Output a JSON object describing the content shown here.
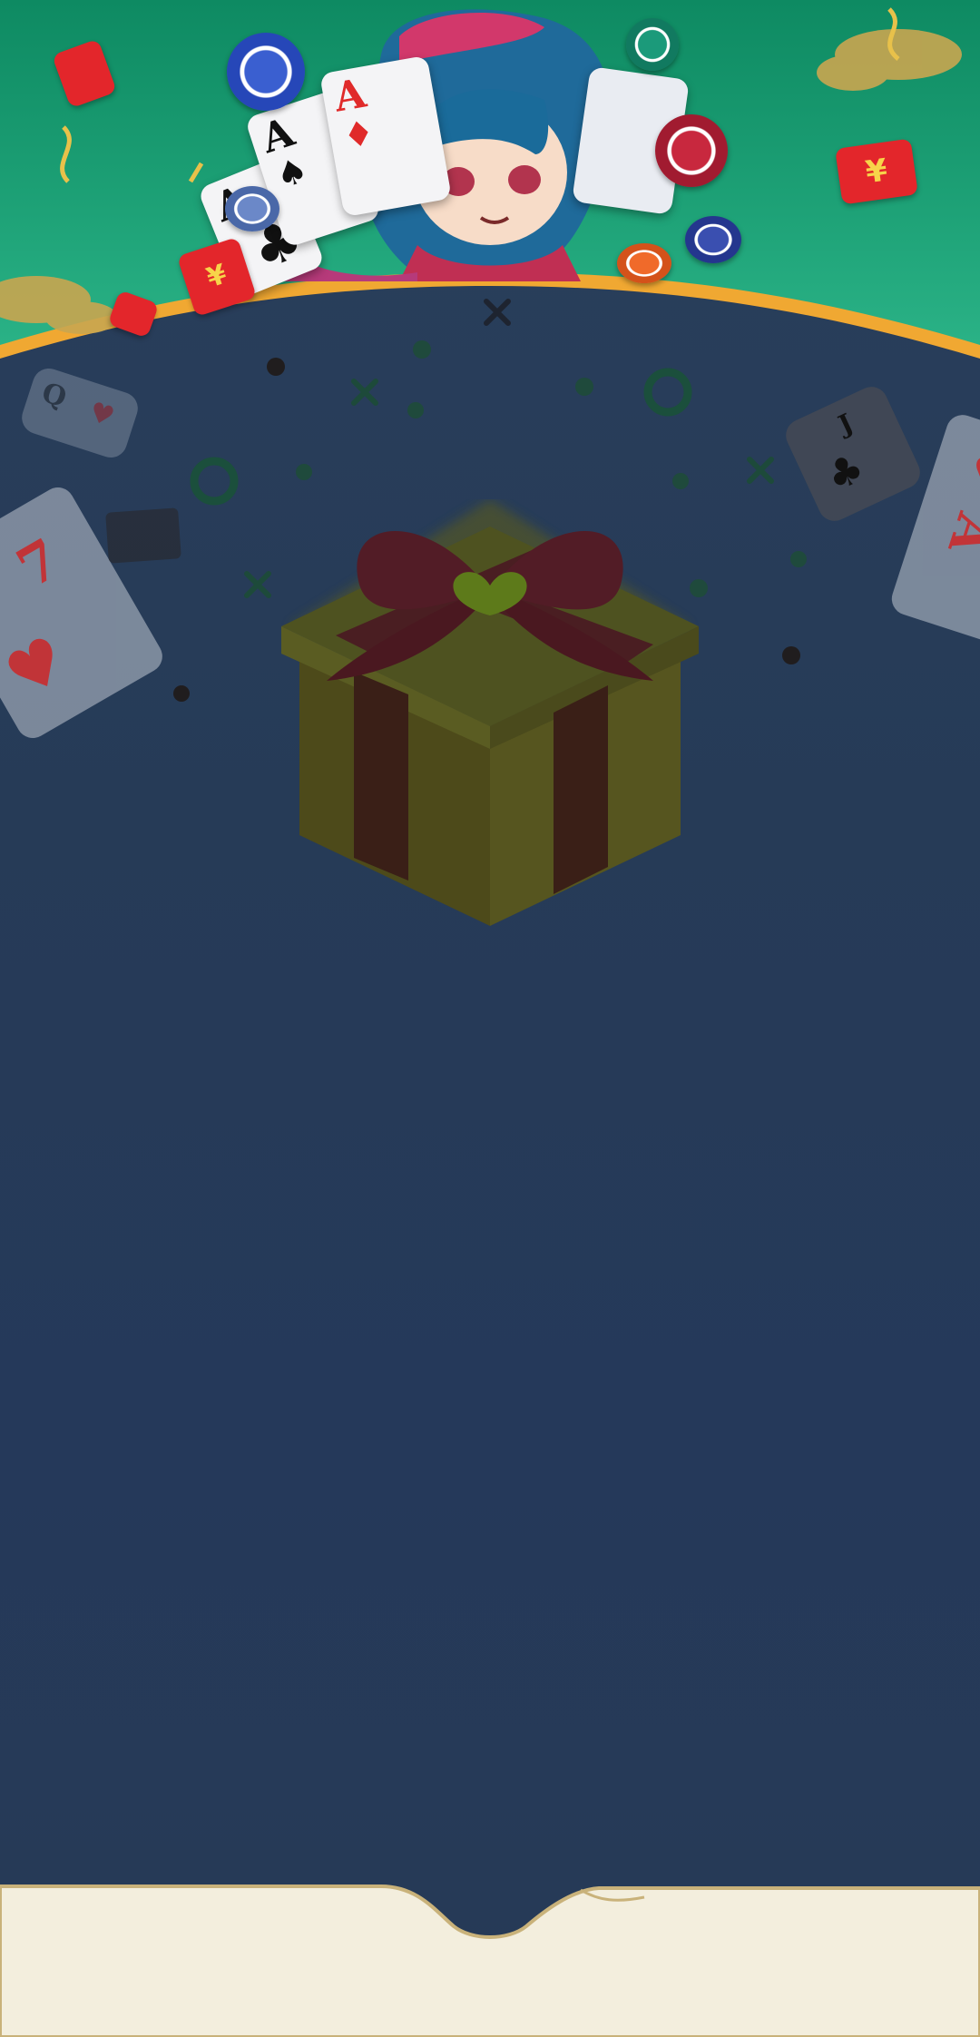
{
  "banner": {
    "character": "chibi-poker-girl",
    "cards": [
      {
        "rank": "A",
        "suit": "♠",
        "color": "black"
      },
      {
        "rank": "A",
        "suit": "♦",
        "color": "red"
      },
      {
        "rank": "A",
        "suit": "♣",
        "color": "black"
      }
    ],
    "red_packet_symbol": "¥"
  },
  "body": {
    "faded_cards": [
      {
        "rank": "Q",
        "suit": "♥"
      },
      {
        "rank": "7",
        "suit": "♥"
      },
      {
        "rank": "J",
        "suit": "♣"
      },
      {
        "rank": "A",
        "suit": "♥"
      }
    ],
    "gift_box": "gift-box-icon"
  },
  "colors": {
    "background": "#263a55",
    "banner_green": "#1f9a6e",
    "banner_border": "#f0a832",
    "footer_cream": "#f3eedd",
    "footer_border": "#c9b27a"
  }
}
